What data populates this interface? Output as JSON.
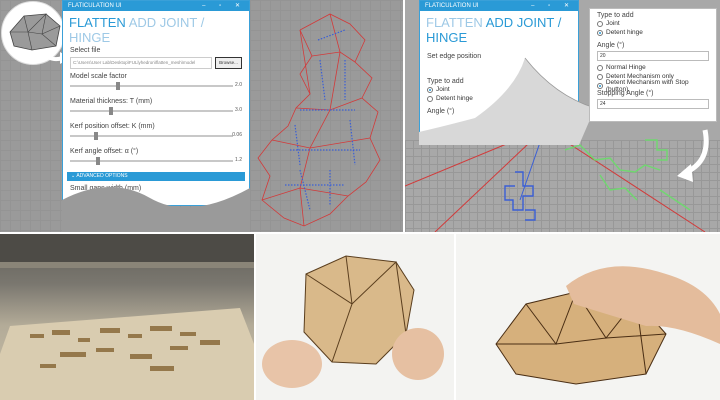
{
  "flatten_window": {
    "app_title": "FLATICULATION UI",
    "tabs": {
      "active": "FLATTEN",
      "inactive": "ADD JOINT / HINGE"
    },
    "select_file_label": "Select file",
    "file_path": "C:\\Users\\User Lab\\Desktop\\FULlyhedron\\flatten_mesh\\model",
    "browse_button": "Browse...",
    "sliders": [
      {
        "label": "Model scale factor",
        "value": "2.0",
        "level": 0.28
      },
      {
        "label": "Material thickness: T (mm)",
        "value": "3.0",
        "level": 0.24
      },
      {
        "label": "Kerf position offset: K (mm)",
        "value": "0.06",
        "level": 0.15
      },
      {
        "label": "Kerf angle offset: α (°)",
        "value": "1.2",
        "level": 0.16
      }
    ],
    "advanced_options": "ADVANCED OPTIONS",
    "small_gaps_label": "Small gaps width (mm)"
  },
  "joint_window": {
    "app_title": "FLATICULATION UI",
    "tabs": {
      "inactive": "FLATTEN",
      "active": "ADD JOINT / HINGE"
    },
    "set_edge_label": "Set edge position",
    "type_to_add_label": "Type to add",
    "joint_option": "Joint",
    "detent_hinge_option": "Detent hinge",
    "angle_label": "Angle (°)"
  },
  "options_popup": {
    "type_to_add_label": "Type to add",
    "joint_option": "Joint",
    "detent_hinge_option": "Detent hinge",
    "angle_label": "Angle (°)",
    "angle_value": "20",
    "normal_hinge_option": "Normal Hinge",
    "detent_only_option": "Detent Mechanism only",
    "detent_stop_option": "Detent Mechanism with Stop (button)",
    "stopping_angle_label": "Stopping Angle (°)",
    "stopping_angle_value": "24"
  },
  "colors": {
    "accent": "#2a9ad6",
    "outline_red": "#d23a3a",
    "pattern_blue": "#3a5fd6",
    "pattern_green": "#6fd86f"
  }
}
